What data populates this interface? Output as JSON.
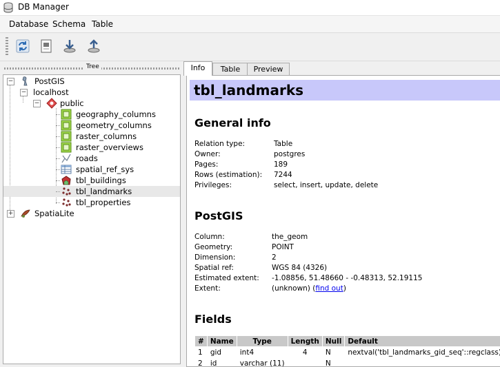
{
  "window": {
    "title": "DB Manager"
  },
  "menu": [
    "Database",
    "Schema",
    "Table"
  ],
  "toolbar": {
    "buttons": [
      "refresh-icon",
      "sql-window-icon",
      "import-layer-icon",
      "export-layer-icon"
    ]
  },
  "tree": {
    "header": "Tree",
    "nodes": [
      {
        "label": "PostGIS",
        "icon": "postgis-icon",
        "expander": "−"
      },
      {
        "label": "localhost",
        "icon": "",
        "expander": "−"
      },
      {
        "label": "public",
        "icon": "schema-icon",
        "expander": "−"
      },
      {
        "label": "geography_columns",
        "icon": "view-icon"
      },
      {
        "label": "geometry_columns",
        "icon": "view-icon"
      },
      {
        "label": "raster_columns",
        "icon": "view-icon"
      },
      {
        "label": "raster_overviews",
        "icon": "view-icon"
      },
      {
        "label": "roads",
        "icon": "line-layer-icon"
      },
      {
        "label": "spatial_ref_sys",
        "icon": "table-icon"
      },
      {
        "label": "tbl_buildings",
        "icon": "polygon-layer-icon"
      },
      {
        "label": "tbl_landmarks",
        "icon": "point-layer-icon",
        "selected": true
      },
      {
        "label": "tbl_properties",
        "icon": "point-layer-icon"
      },
      {
        "label": "SpatiaLite",
        "icon": "spatialite-icon",
        "expander": "+"
      }
    ]
  },
  "tabs": [
    "Info",
    "Table",
    "Preview"
  ],
  "info": {
    "title": "tbl_landmarks",
    "general": {
      "heading": "General info",
      "rows": [
        {
          "k": "Relation type:",
          "v": "Table"
        },
        {
          "k": "Owner:",
          "v": "postgres"
        },
        {
          "k": "Pages:",
          "v": "189"
        },
        {
          "k": "Rows (estimation):",
          "v": "7244"
        },
        {
          "k": "Privileges:",
          "v": "select, insert, update, delete"
        }
      ]
    },
    "postgis": {
      "heading": "PostGIS",
      "rows": [
        {
          "k": "Column:",
          "v": "the_geom"
        },
        {
          "k": "Geometry:",
          "v": "POINT"
        },
        {
          "k": "Dimension:",
          "v": "2"
        },
        {
          "k": "Spatial ref:",
          "v": "WGS 84 (4326)"
        },
        {
          "k": "Estimated extent:",
          "v": "-1.08856, 51.48660 - -0.48313, 52.19115"
        },
        {
          "k": "Extent:",
          "v": "(unknown) (",
          "link": "find out",
          "after": ")"
        }
      ]
    },
    "fields": {
      "heading": "Fields",
      "columns": [
        "#",
        "Name",
        "Type",
        "Length",
        "Null",
        "Default"
      ],
      "rows": [
        [
          "1",
          "gid",
          "int4",
          "4",
          "N",
          "nextval('tbl_landmarks_gid_seq'::regclass)"
        ],
        [
          "2",
          "id",
          "varchar (11)",
          "",
          "N",
          ""
        ]
      ]
    }
  }
}
